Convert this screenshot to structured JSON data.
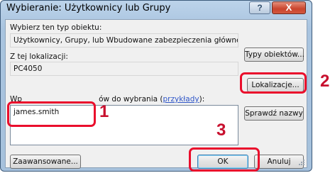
{
  "window": {
    "title": "Wybieranie: Użytkownicy lub Grupy",
    "help_label": "?",
    "close_label": "X"
  },
  "object_type": {
    "label": "Wybierz ten typ obiektu:",
    "value": "Użytkownicy, Grupy, lub Wbudowane zabezpieczenia główne",
    "button": "Typy obiektów..."
  },
  "location": {
    "label": "Z tej lokalizacji:",
    "value": "PC4050",
    "button": "Lokalizacje..."
  },
  "names": {
    "label_start": "Wp",
    "label_middle": "",
    "label_end": "ów do wybrania (",
    "example_link": "przykłady",
    "label_close": "):",
    "value": "james.smith",
    "check_button": "Sprawdź nazwy"
  },
  "footer": {
    "advanced_button": "Zaawansowane...",
    "ok_button": "OK",
    "cancel_button": "Anuluj"
  },
  "callouts": [
    "1",
    "2",
    "3"
  ],
  "colors": {
    "highlight": "#ea0e2c",
    "callout_number": "#c8102e"
  }
}
